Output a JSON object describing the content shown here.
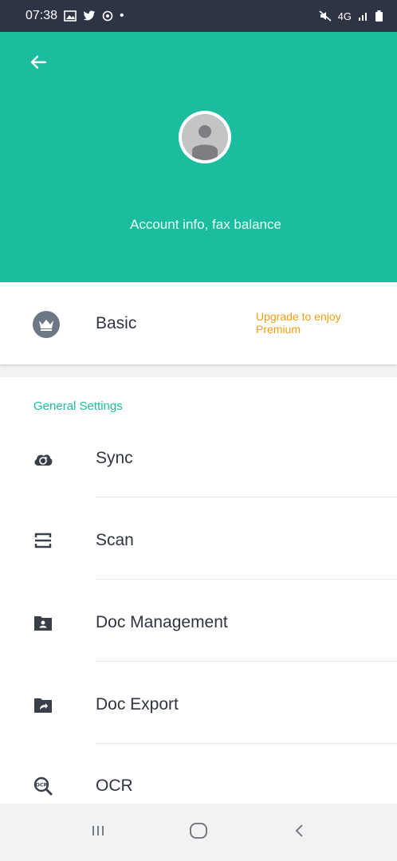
{
  "status_bar": {
    "time": "07:38",
    "dot": "•",
    "network": "4G",
    "left_icons": [
      "gallery-icon",
      "twitter-icon",
      "sync-status-icon"
    ],
    "right_icons": [
      "mute-icon",
      "network-4g-icon",
      "signal-icon",
      "battery-icon"
    ]
  },
  "header": {
    "background_color": "#1bbd9e",
    "back_icon": "arrow-left-icon",
    "avatar_icon": "user-avatar-icon",
    "account_info": "Account info, fax balance"
  },
  "plan": {
    "icon": "crown-icon",
    "name": "Basic",
    "upgrade_text": "Upgrade to enjoy Premium",
    "upgrade_color": "#f39c12"
  },
  "settings": {
    "section_title": "General Settings",
    "accent_color": "#1bbd9e",
    "items": [
      {
        "label": "Sync",
        "icon": "cloud-sync-icon"
      },
      {
        "label": "Scan",
        "icon": "scan-icon"
      },
      {
        "label": "Doc Management",
        "icon": "folder-person-icon"
      },
      {
        "label": "Doc Export",
        "icon": "folder-share-icon"
      },
      {
        "label": "OCR",
        "icon": "ocr-search-icon"
      }
    ]
  },
  "nav_bar": {
    "recents_icon": "recents-icon",
    "home_icon": "home-icon",
    "back_icon": "back-chevron-icon"
  }
}
